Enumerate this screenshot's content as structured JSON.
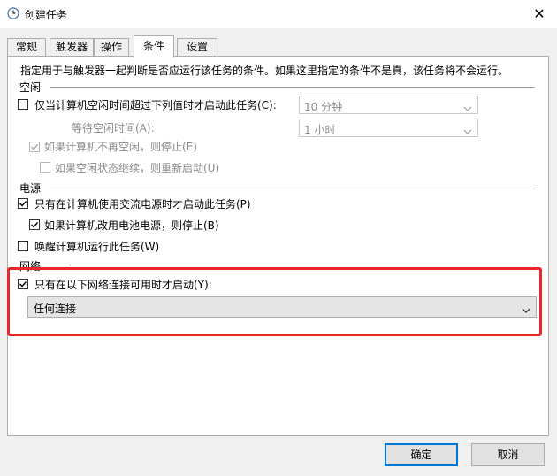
{
  "window": {
    "title": "创建任务"
  },
  "tabs": [
    "常规",
    "触发器",
    "操作",
    "条件",
    "设置"
  ],
  "active_tab": 3,
  "intro": "指定用于与触发器一起判断是否应运行该任务的条件。如果这里指定的条件不是真，该任务将不会运行。",
  "idle": {
    "heading": "空闲",
    "start_if_idle": {
      "label": "仅当计算机空闲时间超过下列值时才启动此任务(C):",
      "checked": false
    },
    "idle_duration": "10 分钟",
    "wait_label": "等待空闲时间(A):",
    "wait_value": "1 小时",
    "stop_if_not_idle": {
      "label": "如果计算机不再空闲，则停止(E)",
      "checked": true
    },
    "restart_if_idle": {
      "label": "如果空闲状态继续，则重新启动(U)",
      "checked": false
    }
  },
  "power": {
    "heading": "电源",
    "ac_only": {
      "label": "只有在计算机使用交流电源时才启动此任务(P)",
      "checked": true
    },
    "stop_on_battery": {
      "label": "如果计算机改用电池电源，则停止(B)",
      "checked": true
    },
    "wake": {
      "label": "唤醒计算机运行此任务(W)",
      "checked": false
    }
  },
  "network": {
    "heading": "网络",
    "start_if_network": {
      "label": "只有在以下网络连接可用时才启动(Y):",
      "checked": true
    },
    "connection": "任何连接"
  },
  "buttons": {
    "ok": "确定",
    "cancel": "取消"
  },
  "colors": {
    "highlight": "#e8262b",
    "primary_border": "#0078d7"
  }
}
